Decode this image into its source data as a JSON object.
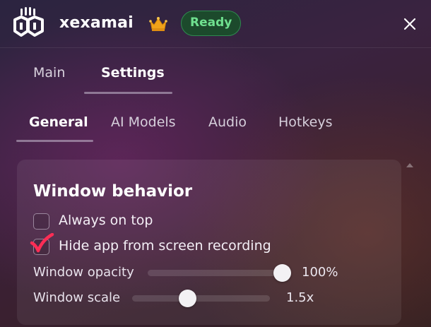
{
  "header": {
    "app_name": "xexamai",
    "status_badge": "Ready",
    "icons": {
      "logo": "app-logo",
      "crown": "crown-icon",
      "close": "close-icon"
    },
    "colors": {
      "badge_bg": "#1c4a2c",
      "badge_text": "#6fe08f",
      "crown": "#f0a21a"
    }
  },
  "top_tabs": [
    {
      "label": "Main",
      "active": false
    },
    {
      "label": "Settings",
      "active": true
    }
  ],
  "sub_tabs": [
    {
      "label": "General",
      "active": true
    },
    {
      "label": "AI Models",
      "active": false
    },
    {
      "label": "Audio",
      "active": false
    },
    {
      "label": "Hotkeys",
      "active": false
    }
  ],
  "window_behavior": {
    "title": "Window behavior",
    "options": [
      {
        "label": "Always on top",
        "checked": false
      },
      {
        "label": "Hide app from screen recording",
        "checked": true
      }
    ],
    "sliders": [
      {
        "label": "Window opacity",
        "value": "100%",
        "fill": 1.0
      },
      {
        "label": "Window scale",
        "value": "1.5x",
        "fill": 0.4
      }
    ]
  }
}
